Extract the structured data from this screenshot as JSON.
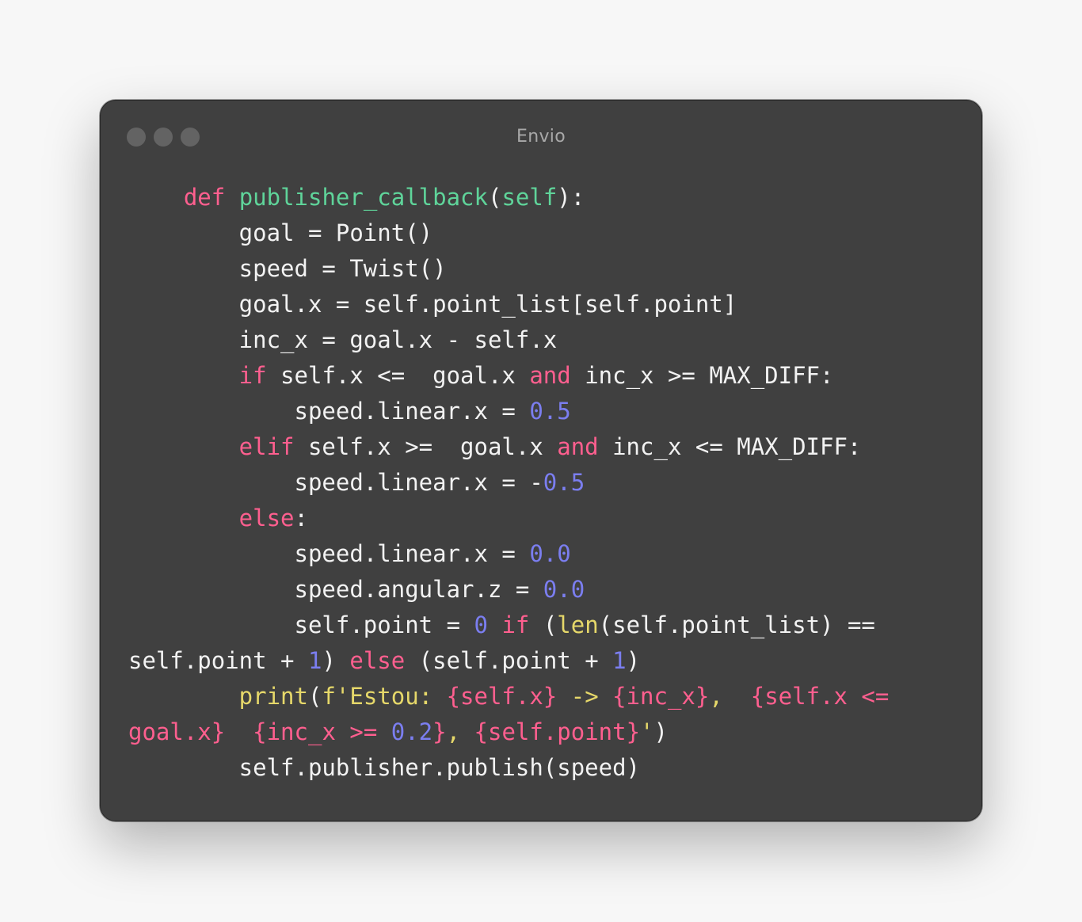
{
  "window": {
    "title": "Envio",
    "colors": {
      "background": "#404040",
      "keyword": "#ff5f8f",
      "function": "#5fd49a",
      "number": "#7b7ef0",
      "builtin": "#e6d86a",
      "text": "#f2f2f2",
      "title": "#a8a8a8"
    }
  },
  "code": {
    "language": "python",
    "lines": [
      [
        [
          "kw",
          "    def"
        ],
        [
          "tx",
          " "
        ],
        [
          "fn",
          "publisher_callback"
        ],
        [
          "tx",
          "("
        ],
        [
          "fn",
          "self"
        ],
        [
          "tx",
          "):"
        ]
      ],
      [
        [
          "tx",
          "        goal = Point()"
        ]
      ],
      [
        [
          "tx",
          "        speed = Twist()"
        ]
      ],
      [
        [
          "tx",
          "        goal.x = self.point_list[self.point]"
        ]
      ],
      [
        [
          "tx",
          "        inc_x = goal.x - self.x"
        ]
      ],
      [
        [
          "kw",
          "        if"
        ],
        [
          "tx",
          " self.x <=  goal.x "
        ],
        [
          "kw",
          "and"
        ],
        [
          "tx",
          " inc_x >= MAX_DIFF:"
        ]
      ],
      [
        [
          "tx",
          "            speed.linear.x = "
        ],
        [
          "num",
          "0.5"
        ]
      ],
      [
        [
          "kw",
          "        elif"
        ],
        [
          "tx",
          " self.x >=  goal.x "
        ],
        [
          "kw",
          "and"
        ],
        [
          "tx",
          " inc_x <= MAX_DIFF:"
        ]
      ],
      [
        [
          "tx",
          "            speed.linear.x = -"
        ],
        [
          "num",
          "0.5"
        ]
      ],
      [
        [
          "kw",
          "        else"
        ],
        [
          "tx",
          ":"
        ]
      ],
      [
        [
          "tx",
          "            speed.linear.x = "
        ],
        [
          "num",
          "0.0"
        ]
      ],
      [
        [
          "tx",
          "            speed.angular.z = "
        ],
        [
          "num",
          "0.0"
        ]
      ],
      [
        [
          "tx",
          "            self.point = "
        ],
        [
          "num",
          "0"
        ],
        [
          "tx",
          " "
        ],
        [
          "kw",
          "if"
        ],
        [
          "tx",
          " ("
        ],
        [
          "bi",
          "len"
        ],
        [
          "tx",
          "(self.point_list) =="
        ]
      ],
      [
        [
          "tx",
          "self.point + "
        ],
        [
          "num",
          "1"
        ],
        [
          "tx",
          ") "
        ],
        [
          "kw",
          "else"
        ],
        [
          "tx",
          " (self.point + "
        ],
        [
          "num",
          "1"
        ],
        [
          "tx",
          ")"
        ]
      ],
      [
        [
          "bi",
          "        print"
        ],
        [
          "tx",
          "("
        ],
        [
          "str",
          "f'Estou: "
        ],
        [
          "kw",
          "{self.x}"
        ],
        [
          "str",
          " -> "
        ],
        [
          "kw",
          "{inc_x}"
        ],
        [
          "str",
          ",  "
        ],
        [
          "kw",
          "{self.x <="
        ]
      ],
      [
        [
          "kw",
          "goal.x}"
        ],
        [
          "str",
          "  "
        ],
        [
          "kw",
          "{inc_x >= "
        ],
        [
          "num",
          "0.2"
        ],
        [
          "kw",
          "}"
        ],
        [
          "str",
          ", "
        ],
        [
          "kw",
          "{self.point}"
        ],
        [
          "str",
          "'"
        ],
        [
          "tx",
          ")"
        ]
      ],
      [
        [
          "tx",
          "        self.publisher.publish(speed)"
        ]
      ]
    ]
  }
}
